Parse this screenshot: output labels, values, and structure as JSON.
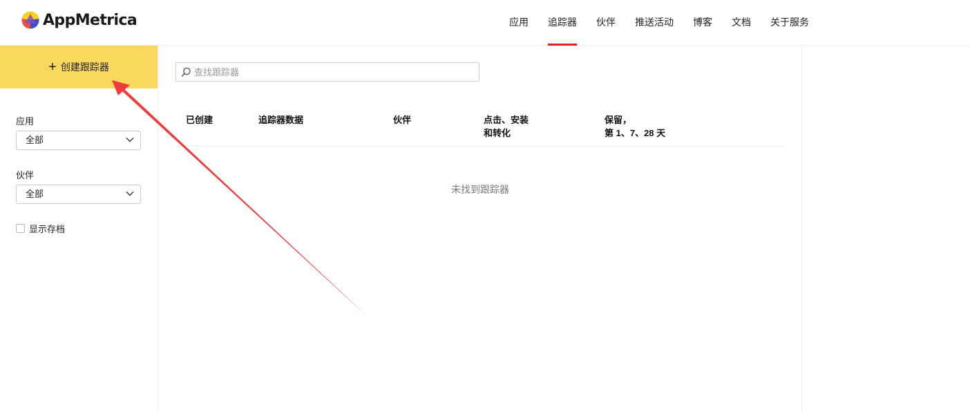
{
  "brand": {
    "name": "AppMetrica",
    "logo_colors": [
      "#fcd116",
      "#e8523f",
      "#3b52c4",
      "#2fa8e0"
    ]
  },
  "nav": {
    "items": [
      {
        "label": "应用"
      },
      {
        "label": "追踪器"
      },
      {
        "label": "伙伴"
      },
      {
        "label": "推送活动"
      },
      {
        "label": "博客"
      },
      {
        "label": "文档"
      },
      {
        "label": "关于服务"
      }
    ],
    "active": "追踪器",
    "active_color": "#e31e1e"
  },
  "sidebar": {
    "create_button": {
      "label": "创建跟踪器",
      "icon": "plus-icon",
      "color": "#fad85e"
    },
    "filters": [
      {
        "label": "应用",
        "value": "全部"
      },
      {
        "label": "伙伴",
        "value": "全部"
      }
    ],
    "show_archive": {
      "label": "显示存档",
      "checked": false
    }
  },
  "search": {
    "placeholder": "查找跟踪器",
    "value": ""
  },
  "table": {
    "columns": [
      {
        "line1": "已创建",
        "line2": ""
      },
      {
        "line1": "追踪器数据",
        "line2": ""
      },
      {
        "line1": "伙伴",
        "line2": ""
      },
      {
        "line1": "点击、安装",
        "line2": "和转化"
      },
      {
        "line1": "保留，",
        "line2": "第 1、7、28 天"
      }
    ],
    "empty_message": "未找到跟踪器"
  },
  "annotation": {
    "type": "arrow",
    "color": "#ef3b3b"
  }
}
